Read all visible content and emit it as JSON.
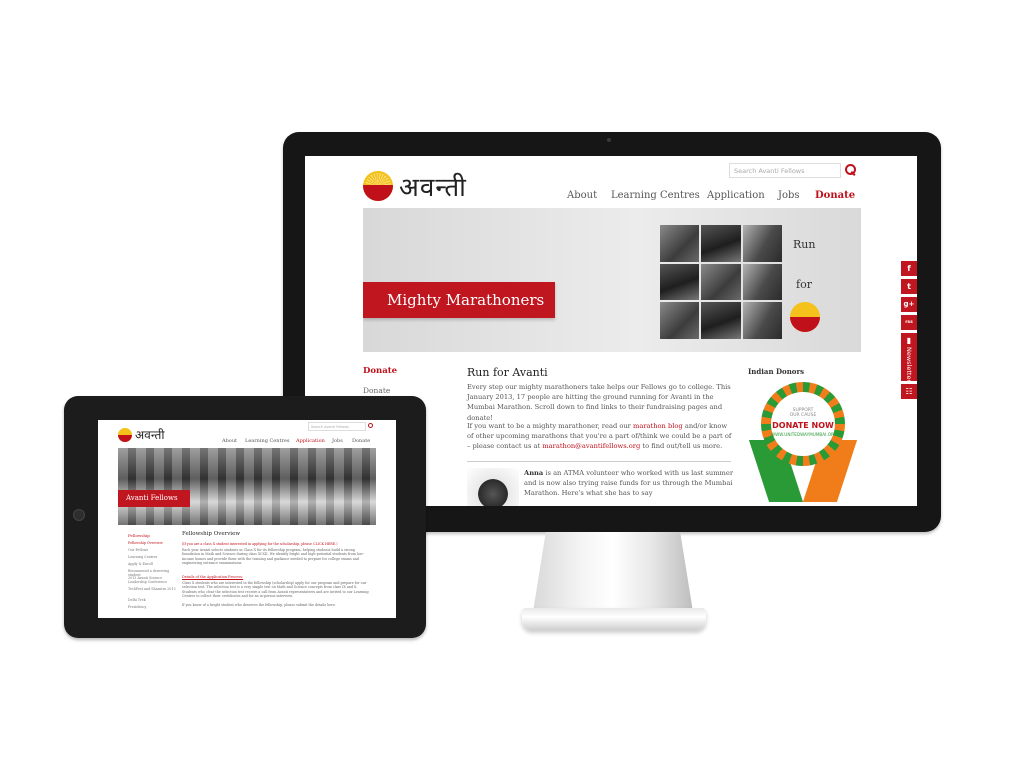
{
  "desktop": {
    "logo_text": "अवन्ती",
    "search_placeholder": "Search Avanti Fellows",
    "nav": [
      "About",
      "Learning Centres",
      "Application",
      "Jobs",
      "Donate"
    ],
    "banner": {
      "tag": "Mighty Marathoners",
      "run": "Run",
      "for": "for"
    },
    "sidebar": {
      "heading": "Donate",
      "item": "Donate"
    },
    "main": {
      "heading": "Run for Avanti",
      "p1": "Every step our mighty marathoners take helps our Fellows go to college. This January 2013, 17 people are hitting the ground running for Avanti in the Mumbai Marathon. Scroll down to find links to their fundraising pages and donate!",
      "p2_a": "If you want to be a mighty marathoner, read our ",
      "p2_link1": "marathon blog",
      "p2_b": " and/or know of other upcoming marathons that you're a part of/think we could be a part of – please contact us at ",
      "p2_link2": "marathon@avantifellows.org",
      "p2_c": " to find out/tell us more.",
      "anna_name": "Anna",
      "anna_text": " is an ATMA volunteer who worked with us last summer and is now also trying raise funds for us through the Mumbai Marathon. Here's what she has to say"
    },
    "right": {
      "heading": "Indian Donors",
      "badge_line1": "SUPPORT",
      "badge_line2": "OUR CAUSE",
      "badge_line3": "DONATE NOW",
      "badge_line4": "WWW.UNITEDWAYMUMBAI.ORG"
    }
  },
  "social": {
    "facebook": "f",
    "twitter": "t",
    "google": "g+",
    "rss": "rss",
    "newsletter": "Newsletter"
  },
  "tablet": {
    "logo_text": "अवन्ती",
    "search_placeholder": "Search Avanti Fellows",
    "nav": [
      "About",
      "Learning Centres",
      "Application",
      "Jobs",
      "Donate"
    ],
    "banner_tag": "Avanti Fellows",
    "sidebar_heading": "Fellowship",
    "sidebar_items": [
      "Fellowship Overview",
      "Our Fellows",
      "Learning Centres",
      "Apply & Enroll",
      "Recommend a deserving student",
      "2013 Avanti Science Leadership Conference",
      "TechFest and Shaastra 2013",
      "Delhi Trek",
      "Presidency"
    ],
    "main_heading": "Fellowship Overview",
    "red_note": "(If you are a class X student interested in applying for the scholarship, please CLICK HERE.)",
    "p1": "Each year Avanti selects students in Class X for its fellowship program, helping students build a strong foundation in Math and Science during class XI-XII. We identify bright and high-potential students from low-income homes and provide them with the training and guidance needed to prepare for college exams and engineering entrance examinations.",
    "sub": "Details of the Application Process:",
    "p2": "Class X students who are interested in the fellowship (scholarship) apply for our program and prepare for our selection test. The selection test is a very simple test on Math and Science concepts from class IX and X. Students who clear the selection test receive a call from Avanti representatives and are invited to our Learning Centres to collect their certificates and for an in-person interview.",
    "p3": "If you know of a bright student who deserves the fellowship, please submit the details here."
  }
}
